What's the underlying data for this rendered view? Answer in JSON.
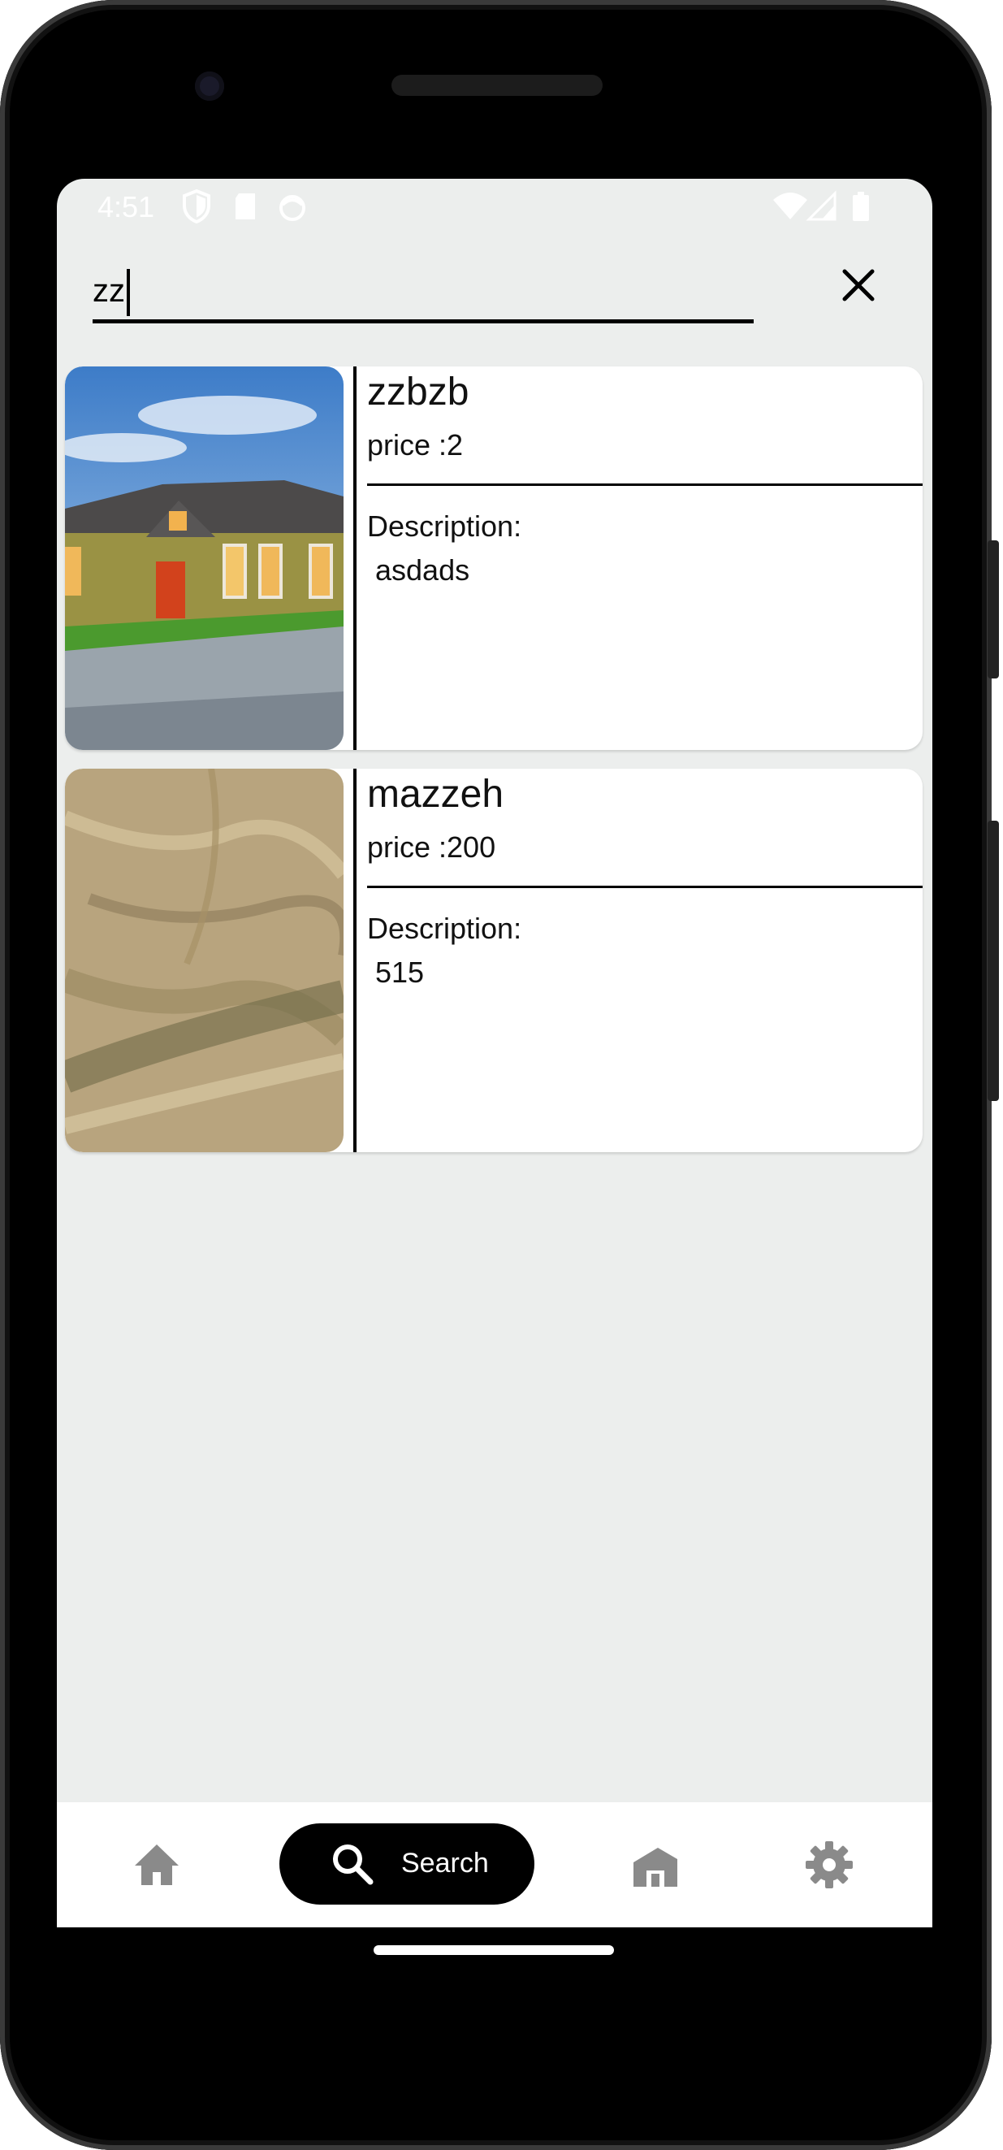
{
  "status_bar": {
    "time": "4:51"
  },
  "search": {
    "value": "zz"
  },
  "results": [
    {
      "title": "zzbzb",
      "price": "price :2",
      "description_label": "Description:",
      "description": "asdads"
    },
    {
      "title": "mazzeh",
      "price": "price :200",
      "description_label": "Description:",
      "description": "515"
    }
  ],
  "bottom_nav": {
    "items": [
      {
        "icon": "home-icon",
        "label": ""
      },
      {
        "icon": "search-icon",
        "label": "Search",
        "active": true
      },
      {
        "icon": "real-estate-icon",
        "label": ""
      },
      {
        "icon": "gear-icon",
        "label": ""
      }
    ]
  },
  "colors": {
    "screen_bg": "#eceeed",
    "active_nav": "#000000",
    "nav_icon": "#8a8a8a"
  }
}
